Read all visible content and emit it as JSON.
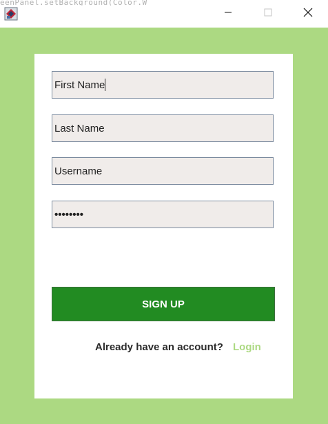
{
  "window": {
    "icon": "java-app-icon",
    "background_code_snippet": "eenPanel.setBackground(Color.W",
    "controls": {
      "minimize_icon": "minimize-icon",
      "maximize_icon": "maximize-icon",
      "close_icon": "close-icon"
    }
  },
  "colors": {
    "background": "#acd982",
    "panel": "#ffffff",
    "field_bg": "#f0ecea",
    "field_border": "#7a8a9e",
    "button": "#228b22",
    "button_text": "#ffffff",
    "link": "#acd982",
    "text": "#2b2b2b"
  },
  "form": {
    "first_name": "First Name",
    "last_name": "Last Name",
    "username": "Username",
    "password": "••••••••",
    "signup_label": "SIGN UP",
    "account_prompt": "Already have an account?",
    "login_label": "Login"
  }
}
